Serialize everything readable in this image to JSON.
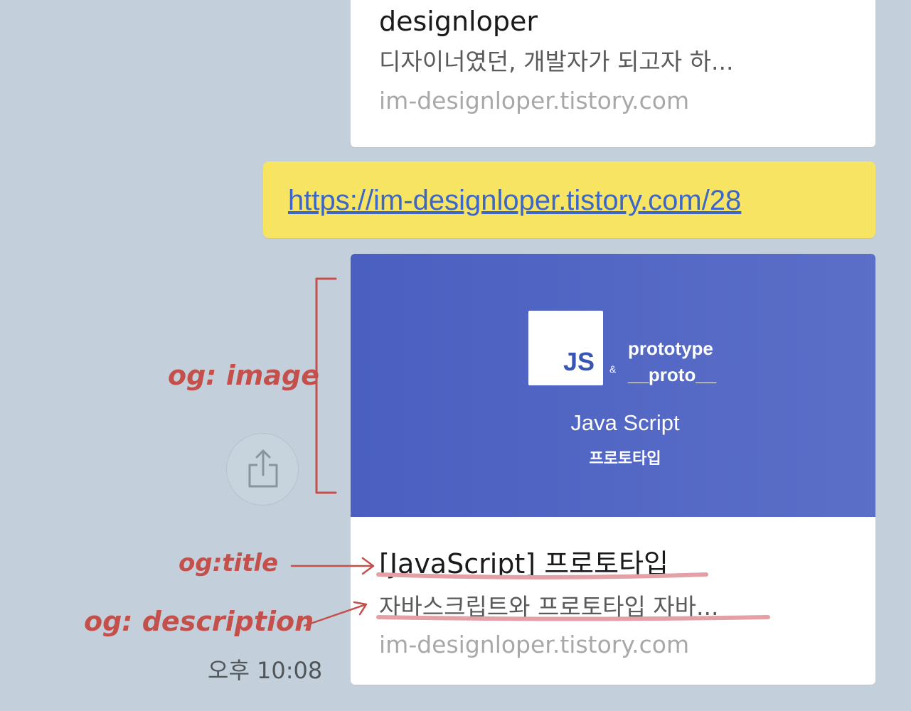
{
  "previous_card": {
    "title": "designloper",
    "description": "디자이너였던, 개발자가 되고자 하...",
    "domain": "im-designloper.tistory.com"
  },
  "message": {
    "url": "https://im-designloper.tistory.com/28"
  },
  "link_card": {
    "image": {
      "badge": "JS",
      "ampersand": "&",
      "line1": "prototype",
      "line2": "__proto__",
      "heading": "Java Script",
      "subheading": "프로토타입"
    },
    "title": "[JavaScript] 프로토타입",
    "description": "자바스크립트와 프로토타입 자바...",
    "domain": "im-designloper.tistory.com"
  },
  "timestamp": "오후 10:08",
  "annotations": {
    "image": "og: image",
    "title": "og:title",
    "description": "og: description"
  },
  "icons": {
    "share": "share-icon"
  },
  "colors": {
    "background": "#c3d0db",
    "bubble": "#f7e463",
    "link": "#3c67c8",
    "annotation": "#c4504c",
    "image_bg": "#4a5fc0"
  }
}
